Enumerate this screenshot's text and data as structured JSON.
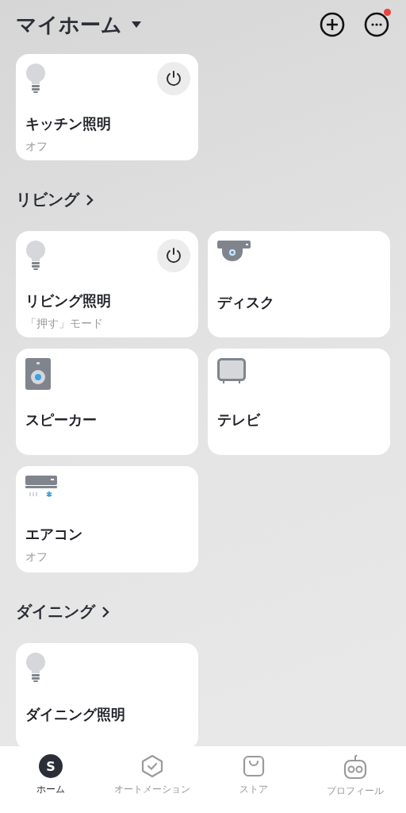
{
  "header": {
    "title": "マイホーム",
    "notification": true
  },
  "devices": [
    {
      "kind": "light",
      "name": "キッチン照明",
      "status": "オフ",
      "power_button": true
    }
  ],
  "rooms": [
    {
      "name": "リビング",
      "devices": [
        {
          "kind": "light",
          "name": "リビング照明",
          "status": "「押す」モード",
          "power_button": true
        },
        {
          "kind": "camera",
          "name": "ディスク",
          "power_button": false
        },
        {
          "kind": "speaker",
          "name": "スピーカー",
          "power_button": false
        },
        {
          "kind": "tv",
          "name": "テレビ",
          "power_button": false
        },
        {
          "kind": "aircon",
          "name": "エアコン",
          "status": "オフ",
          "power_button": false
        }
      ]
    },
    {
      "name": "ダイニング",
      "devices": [
        {
          "kind": "light",
          "name": "ダイニング照明",
          "power_button": false
        }
      ]
    }
  ],
  "tabs": [
    {
      "kind": "home",
      "label": "ホーム",
      "badge_letter": "S",
      "selected": true
    },
    {
      "kind": "automation",
      "label": "オートメーション",
      "selected": false
    },
    {
      "kind": "store",
      "label": "ストア",
      "selected": false
    },
    {
      "kind": "profile",
      "label": "プロフィール",
      "selected": false
    }
  ]
}
